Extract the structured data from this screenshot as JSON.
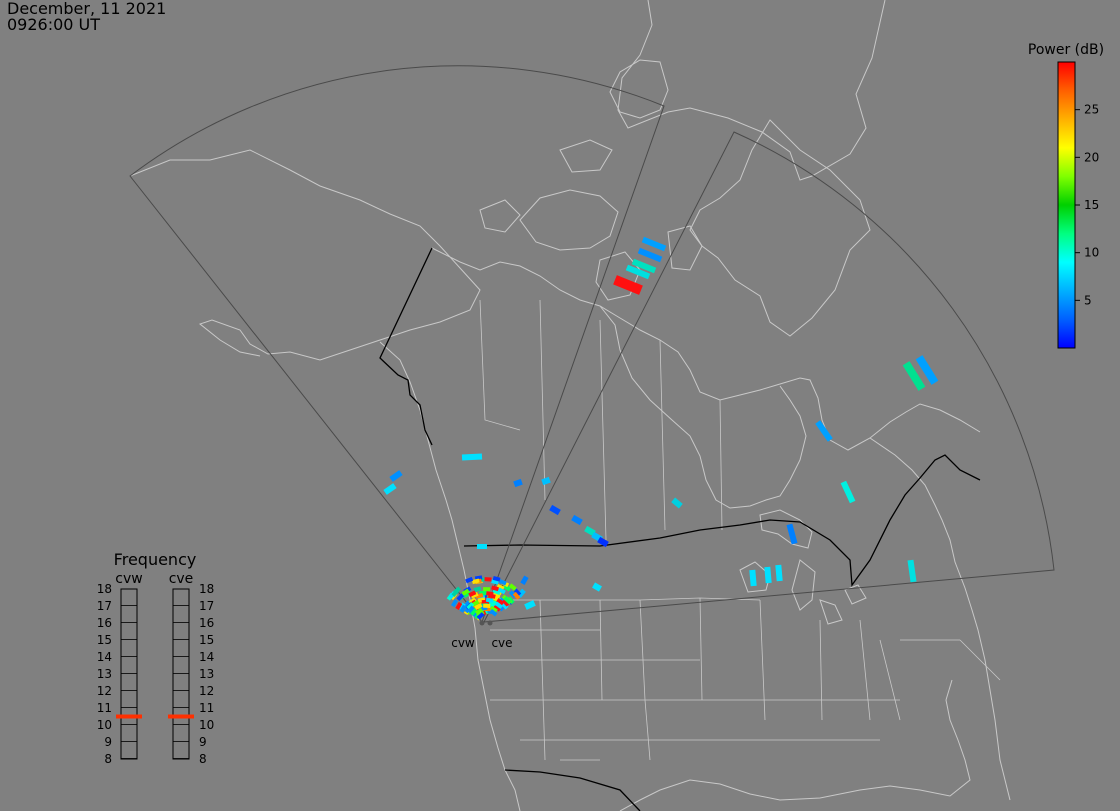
{
  "header": {
    "date": "December, 11 2021",
    "time": "0926:00 UT"
  },
  "colorbar": {
    "title": "Power (dB)",
    "ticks": [
      "5",
      "10",
      "15",
      "20",
      "25"
    ],
    "stops": [
      "#0000ff",
      "#0060ff",
      "#00b0ff",
      "#00ffff",
      "#00ff80",
      "#00d000",
      "#80ff00",
      "#ffff00",
      "#ffb000",
      "#ff6000",
      "#ff0000"
    ]
  },
  "frequency_panel": {
    "title": "Frequency",
    "radars": [
      "cvw",
      "cve"
    ],
    "ticks": [
      "18",
      "17",
      "16",
      "15",
      "14",
      "13",
      "12",
      "11",
      "10",
      "9",
      "8"
    ],
    "cvw_mhz": 10.5,
    "cve_mhz": 10.5,
    "marker_color": "#ff3000"
  },
  "stations": [
    "cvw",
    "cve"
  ],
  "colors": {
    "background": "#808080",
    "coastline": "#c8c8c8",
    "border": "#000000",
    "fov": "#4a4a4a"
  }
}
